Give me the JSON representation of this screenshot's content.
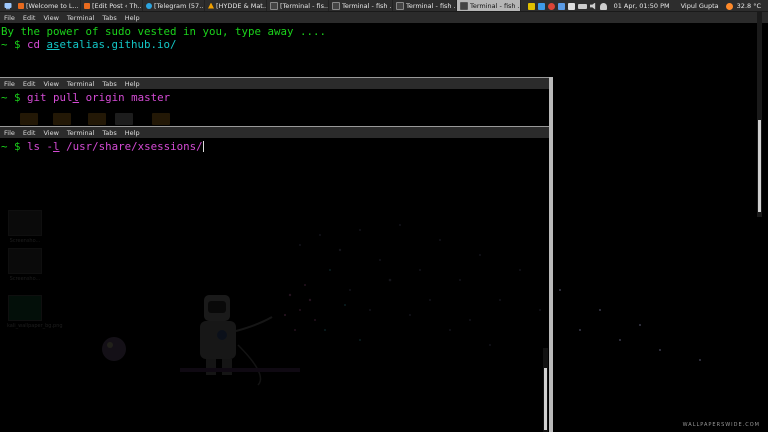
{
  "panel": {
    "tasks": [
      {
        "label": "[Welcome to L...",
        "icon_color": "#e86a1e"
      },
      {
        "label": "[Edit Post ‹ Th...",
        "icon_color": "#e86a1e"
      },
      {
        "label": "[Telegram (57...",
        "icon_color": "#2ca5e0"
      },
      {
        "label": "[HYDDE & Mat...",
        "icon_color": "#f0a000"
      },
      {
        "label": "[Terminal - fis...",
        "icon_color": "#444444"
      },
      {
        "label": "Terminal - fish ...",
        "icon_color": "#444444"
      },
      {
        "label": "Terminal - fish ...",
        "icon_color": "#444444"
      },
      {
        "label": "Terminal - fish ...",
        "icon_color": "#444444",
        "active": true
      }
    ],
    "datetime": "01 Apr, 01:50 PM",
    "user": "Vipul Gupta",
    "temperature": "32.8 °C"
  },
  "menu": [
    "File",
    "Edit",
    "View",
    "Terminal",
    "Tabs",
    "Help"
  ],
  "terminal1": {
    "line1": "By the power of sudo vested in you, type away ....",
    "prompt": "~ $ ",
    "cmd": "cd ",
    "arg_underlined": "as",
    "arg_rest": "etalias.github.io/"
  },
  "terminal2": {
    "prompt": "~ $ ",
    "cmd": "git ",
    "arg_a": "pul",
    "arg_underlined": "l",
    "arg_rest": " origin master"
  },
  "terminal3": {
    "prompt": "~ $ ",
    "cmd": "ls ",
    "arg_a": "-",
    "arg_underlined": "l",
    "arg_rest": " /usr/share/xsessions/"
  },
  "desktop_icons": [
    "Screensho...",
    "Screensho...",
    "kali_wallpaper_bg.png"
  ],
  "watermark": "WALLPAPERSWIDE.COM",
  "colors": {
    "prompt_green": "#1bd21b",
    "command_magenta": "#d44bd4",
    "path_cyan": "#13c6c6",
    "active_task": "#b6b6b6"
  }
}
